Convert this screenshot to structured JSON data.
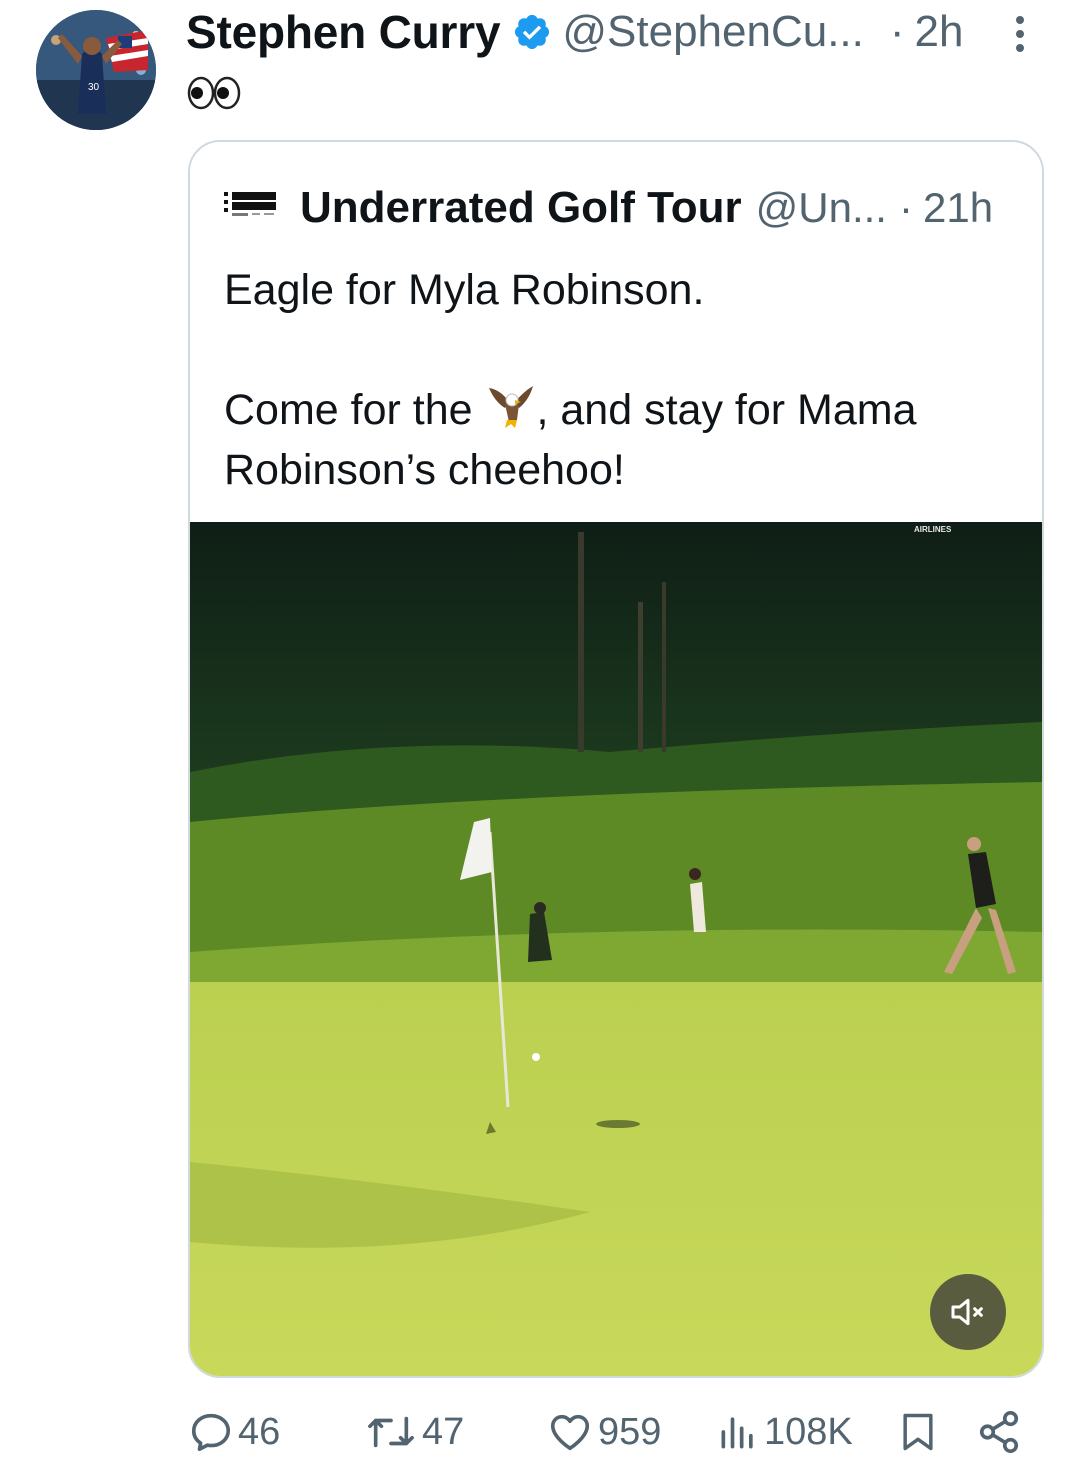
{
  "tweet": {
    "author_name": "Stephen Curry",
    "author_handle": "@StephenCu...",
    "separator": "·",
    "time": "2h",
    "text": "👀"
  },
  "quoted": {
    "author_name": "Underrated Golf Tour",
    "author_handle": "@Un...",
    "separator": "·",
    "time": "21h",
    "line1": "Eagle for Myla Robinson.",
    "line2_before": "Come for the ",
    "line2_after": ", and stay for Mama Robinson’s cheehoo!",
    "video_overlay_text": "AIRLINES"
  },
  "actions": {
    "replies": "46",
    "reposts": "47",
    "likes": "959",
    "views": "108K"
  },
  "colors": {
    "text_primary": "#0f1419",
    "text_secondary": "#536471",
    "verified_blue": "#1d9bf0",
    "card_border": "#cfd9de"
  },
  "icons": {
    "verified": "verified-badge-icon",
    "more": "more-vertical-icon",
    "reply": "reply-icon",
    "repost": "repost-icon",
    "like": "heart-icon",
    "views": "views-icon",
    "bookmark": "bookmark-icon",
    "share": "share-icon",
    "mute": "muted-speaker-icon"
  }
}
